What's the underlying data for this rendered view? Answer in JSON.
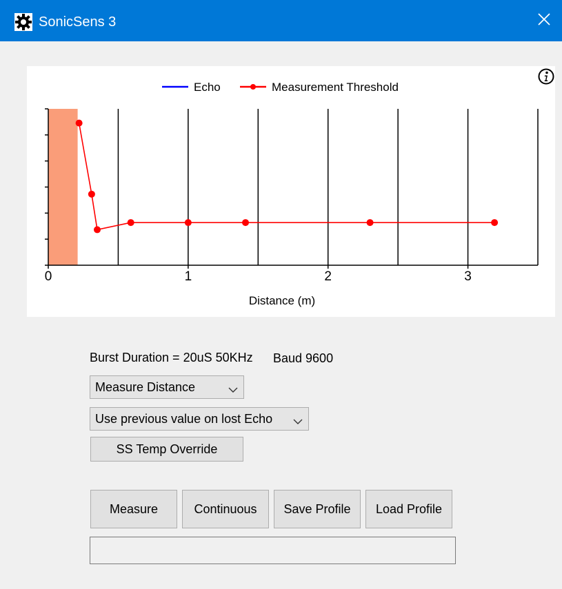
{
  "window": {
    "title": "SonicSens 3",
    "accent_color": "#0078d7",
    "icons": {
      "app": "gear-icon",
      "close": "close-icon",
      "info": "info-icon"
    }
  },
  "chart_data": {
    "type": "line",
    "xlabel": "Distance (m)",
    "xlim": [
      0,
      3.5
    ],
    "x_ticks": [
      "0",
      "1",
      "2",
      "3"
    ],
    "x_tick_values": [
      0,
      1,
      2,
      3
    ],
    "vertical_gridlines": [
      0.5,
      1,
      1.5,
      2,
      2.5,
      3,
      3.5
    ],
    "legend_position": "top-center",
    "blanking_zone": {
      "x_end": 0.21,
      "color": "#fa9d79"
    },
    "series": [
      {
        "name": "Echo",
        "color": "#0000ff",
        "x": [],
        "y": []
      },
      {
        "name": "Measurement Threshold",
        "color": "#ff0000",
        "x": [
          0.22,
          0.31,
          0.35,
          0.59,
          1.0,
          1.41,
          2.3,
          3.19
        ],
        "y": [
          100,
          50,
          25,
          30,
          30,
          30,
          30,
          30
        ]
      }
    ]
  },
  "settings": {
    "burst_duration": "Burst Duration = 20uS 50KHz",
    "baud": "Baud 9600",
    "mode_select": "Measure Distance",
    "lost_echo_select": "Use previous value on lost Echo",
    "ss_temp_override": "SS Temp Override"
  },
  "actions": {
    "measure": "Measure",
    "continuous": "Continuous",
    "save_profile": "Save Profile",
    "load_profile": "Load Profile"
  },
  "status": {
    "text": ""
  }
}
